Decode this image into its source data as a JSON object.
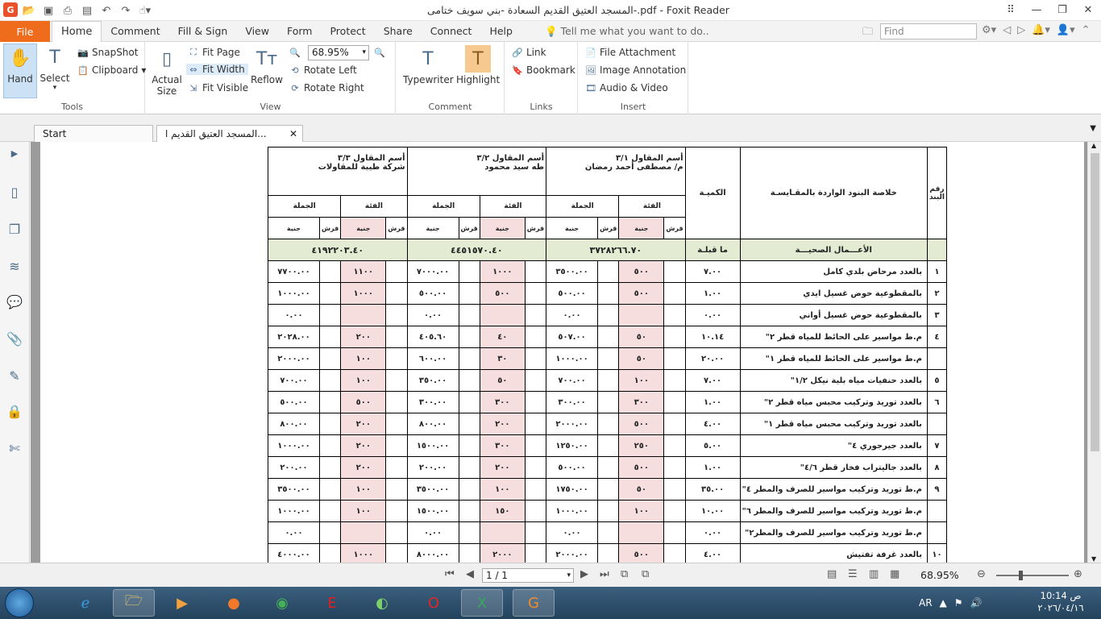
{
  "window": {
    "title": "المسجد العتيق القديم  السعادة -بني سويف  ختامى-.pdf - Foxit Reader"
  },
  "menu": {
    "file": "File",
    "tabs": [
      "Home",
      "Comment",
      "Fill & Sign",
      "View",
      "Form",
      "Protect",
      "Share",
      "Connect",
      "Help"
    ],
    "tell_me": "Tell me what you want to do..",
    "find_placeholder": "Find"
  },
  "ribbon": {
    "tools": {
      "label": "Tools",
      "hand": "Hand",
      "select": "Select",
      "snapshot": "SnapShot",
      "clipboard": "Clipboard"
    },
    "view": {
      "label": "View",
      "actual_size_1": "Actual",
      "actual_size_2": "Size",
      "fit_page": "Fit Page",
      "fit_width": "Fit Width",
      "fit_visible": "Fit Visible",
      "reflow": "Reflow",
      "zoom": "68.95%",
      "rotate_left": "Rotate Left",
      "rotate_right": "Rotate Right"
    },
    "comment": {
      "label": "Comment",
      "typewriter": "Typewriter",
      "highlight": "Highlight"
    },
    "links": {
      "label": "Links",
      "link": "Link",
      "bookmark": "Bookmark"
    },
    "insert": {
      "label": "Insert",
      "file_attachment": "File Attachment",
      "image_annotation": "Image Annotation",
      "audio_video": "Audio & Video"
    }
  },
  "doc_tabs": {
    "start": "Start",
    "current": "المسجد العتيق القديم  ا..."
  },
  "table": {
    "hdr": {
      "item_no": "رقم البند",
      "summary": "خلاصة البنود الواردة بالمقـايسـة",
      "qty": "الكميـة",
      "c1": "أسم المقاول ٣/١\nم/ مصطفى أحمد رمضان",
      "c2": "أسم المقاول ٣/٢\nطه سيد محمود",
      "c3": "أسم المقاول ٣/٣\nشركة طيبة للمقاولات",
      "rate": "الفئة",
      "total": "الجملة",
      "pst": "قرش",
      "eg": "جنية"
    },
    "section": {
      "title": "الأعـــمال الصحيـــة",
      "qty": "ما قبلـة",
      "t1": "٣٧٢٨٢٦٦.٧٠",
      "t2": "٤٤٥١٥٧٠.٤٠",
      "t3": "٤١٩٢٢٠٣.٤٠"
    },
    "rows": [
      {
        "no": "١",
        "desc": "بالعدد مرحاض بلدي كامل",
        "qty": "٧.٠٠",
        "r1": "٥٠٠",
        "g1": "٣٥٠٠.٠٠",
        "r2": "١٠٠٠",
        "g2": "٧٠٠٠.٠٠",
        "r3": "١١٠٠",
        "g3": "٧٧٠٠.٠٠"
      },
      {
        "no": "٢",
        "desc": "بالمقطوعية حوض غسيل ايدي",
        "qty": "١.٠٠",
        "r1": "٥٠٠",
        "g1": "٥٠٠.٠٠",
        "r2": "٥٠٠",
        "g2": "٥٠٠.٠٠",
        "r3": "١٠٠٠",
        "g3": "١٠٠٠.٠٠"
      },
      {
        "no": "٣",
        "desc": "بالمقطوعية حوض غسيل أواني",
        "qty": "٠.٠٠",
        "r1": "",
        "g1": "٠.٠٠",
        "r2": "",
        "g2": "٠.٠٠",
        "r3": "",
        "g3": "٠.٠٠"
      },
      {
        "no": "٤",
        "desc": "م.ط مواسير على الحائط للمياه قطر ٢\"",
        "qty": "١٠.١٤",
        "r1": "٥٠",
        "g1": "٥٠٧.٠٠",
        "r2": "٤٠",
        "g2": "٤٠٥.٦٠",
        "r3": "٢٠٠",
        "g3": "٢٠٢٨.٠٠"
      },
      {
        "no": "",
        "desc": "م.ط مواسير على الحائط للمياه قطر ١\"",
        "qty": "٢٠.٠٠",
        "r1": "٥٠",
        "g1": "١٠٠٠.٠٠",
        "r2": "٣٠",
        "g2": "٦٠٠.٠٠",
        "r3": "١٠٠",
        "g3": "٢٠٠٠.٠٠"
      },
      {
        "no": "٥",
        "desc": "بالعدد حنفيات مياه بلية نيكل ١/٢\"",
        "qty": "٧.٠٠",
        "r1": "١٠٠",
        "g1": "٧٠٠.٠٠",
        "r2": "٥٠",
        "g2": "٣٥٠.٠٠",
        "r3": "١٠٠",
        "g3": "٧٠٠.٠٠"
      },
      {
        "no": "٦",
        "desc": "بالعدد توريد وتركيب محبس مياه قطر ٢\"",
        "qty": "١.٠٠",
        "r1": "٣٠٠",
        "g1": "٣٠٠.٠٠",
        "r2": "٣٠٠",
        "g2": "٣٠٠.٠٠",
        "r3": "٥٠٠",
        "g3": "٥٠٠.٠٠"
      },
      {
        "no": "",
        "desc": "بالعدد توريد وتركيب محبس مياه قطر ١\"",
        "qty": "٤.٠٠",
        "r1": "٥٠٠",
        "g1": "٢٠٠٠.٠٠",
        "r2": "٢٠٠",
        "g2": "٨٠٠.٠٠",
        "r3": "٢٠٠",
        "g3": "٨٠٠.٠٠"
      },
      {
        "no": "٧",
        "desc": "بالعدد جيرجوري ٤\"",
        "qty": "٥.٠٠",
        "r1": "٢٥٠",
        "g1": "١٢٥٠.٠٠",
        "r2": "٣٠٠",
        "g2": "١٥٠٠.٠٠",
        "r3": "٢٠٠",
        "g3": "١٠٠٠.٠٠"
      },
      {
        "no": "٨",
        "desc": "بالعدد جاليتراب فخار قطر ٤/٦\"",
        "qty": "١.٠٠",
        "r1": "٥٠٠",
        "g1": "٥٠٠.٠٠",
        "r2": "٢٠٠",
        "g2": "٢٠٠.٠٠",
        "r3": "٢٠٠",
        "g3": "٢٠٠.٠٠"
      },
      {
        "no": "٩",
        "desc": "م.ط توريد وتركيب مواسير للصرف والمطر ٤\"",
        "qty": "٣٥.٠٠",
        "r1": "٥٠",
        "g1": "١٧٥٠.٠٠",
        "r2": "١٠٠",
        "g2": "٣٥٠٠.٠٠",
        "r3": "١٠٠",
        "g3": "٣٥٠٠.٠٠"
      },
      {
        "no": "",
        "desc": "م.ط توريد وتركيب مواسير للصرف والمطر ٦\"",
        "qty": "١٠.٠٠",
        "r1": "١٠٠",
        "g1": "١٠٠٠.٠٠",
        "r2": "١٥٠",
        "g2": "١٥٠٠.٠٠",
        "r3": "١٠٠",
        "g3": "١٠٠٠.٠٠"
      },
      {
        "no": "",
        "desc": "م.ط توريد وتركيب مواسير للصرف والمطر٢\"",
        "qty": "٠.٠٠",
        "r1": "",
        "g1": "٠.٠٠",
        "r2": "",
        "g2": "٠.٠٠",
        "r3": "",
        "g3": "٠.٠٠"
      },
      {
        "no": "١٠",
        "desc": "بالعدد غرفة تفتيش",
        "qty": "٤.٠٠",
        "r1": "٥٠٠",
        "g1": "٢٠٠٠.٠٠",
        "r2": "٢٠٠٠",
        "g2": "٨٠٠٠.٠٠",
        "r3": "١٠٠٠",
        "g3": "٤٠٠٠.٠٠"
      }
    ]
  },
  "status": {
    "page": "1 / 1",
    "zoom": "68.95%"
  },
  "taskbar": {
    "lang": "AR",
    "time": "10:14 ص",
    "date": "٢٠٢٦/٠٤/١٦"
  }
}
